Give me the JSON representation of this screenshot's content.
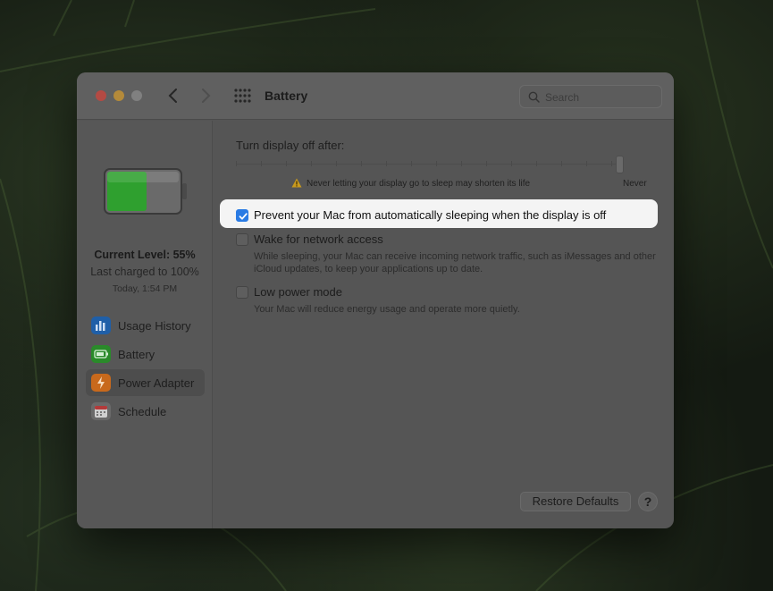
{
  "window": {
    "title": "Battery",
    "search_placeholder": "Search"
  },
  "sidebar": {
    "current_level": "Current Level: 55%",
    "last_charged": "Last charged to 100%",
    "charged_time": "Today, 1:54 PM",
    "battery_fill": 0.55,
    "items": [
      {
        "label": "Usage History",
        "icon": "usage-history-icon",
        "color": "#1f5fa8"
      },
      {
        "label": "Battery",
        "icon": "battery-icon",
        "color": "#2a8a2a"
      },
      {
        "label": "Power Adapter",
        "icon": "power-adapter-icon",
        "color": "#c8691c"
      },
      {
        "label": "Schedule",
        "icon": "schedule-icon",
        "color": "#d0d0d0"
      }
    ],
    "selected_index": 2
  },
  "display": {
    "label": "Turn display off after:",
    "warning": "Never letting your display go to sleep may shorten its life",
    "never_label": "Never"
  },
  "options": {
    "prevent_sleep": {
      "label": "Prevent your Mac from automatically sleeping when the display is off",
      "checked": true
    },
    "wake_network": {
      "label": "Wake for network access",
      "description": "While sleeping, your Mac can receive incoming network traffic, such as iMessages and other iCloud updates, to keep your applications up to date.",
      "checked": false
    },
    "low_power": {
      "label": "Low power mode",
      "description": "Your Mac will reduce energy usage and operate more quietly.",
      "checked": false
    }
  },
  "footer": {
    "restore_label": "Restore Defaults",
    "help_label": "?"
  },
  "colors": {
    "accent": "#2a7be4",
    "battery_green": "#2fa02f"
  }
}
